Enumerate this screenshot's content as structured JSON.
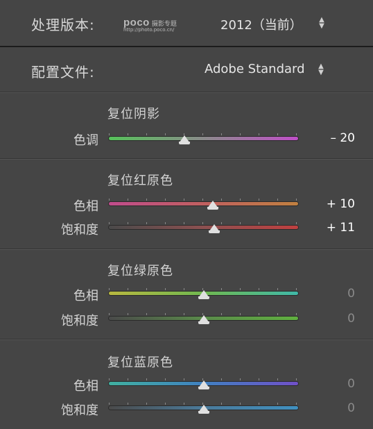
{
  "header": {
    "process_label": "处理版本:",
    "process_value": "2012（当前）",
    "profile_label": "配置文件:",
    "profile_value": "Adobe Standard"
  },
  "watermark": {
    "brand": "poco",
    "tagline": "摄影专题",
    "url": "http://photo.poco.cn/"
  },
  "groups": [
    {
      "title": "复位阴影",
      "rows": [
        {
          "label": "色调",
          "value": "– 20",
          "level": 0.4
        }
      ]
    },
    {
      "title": "复位红原色",
      "rows": [
        {
          "label": "色相",
          "value": "+ 10",
          "level": 0.55
        },
        {
          "label": "饱和度",
          "value": "+ 11",
          "level": 0.555
        }
      ]
    },
    {
      "title": "复位绿原色",
      "rows": [
        {
          "label": "色相",
          "value": "0",
          "level": 0.5
        },
        {
          "label": "饱和度",
          "value": "0",
          "level": 0.5
        }
      ]
    },
    {
      "title": "复位蓝原色",
      "rows": [
        {
          "label": "色相",
          "value": "0",
          "level": 0.5
        },
        {
          "label": "饱和度",
          "value": "0",
          "level": 0.5
        }
      ]
    }
  ],
  "colors": {
    "background": "#454545",
    "shadow_tint_track": [
      "#56c25a",
      "#8a8a8a",
      "#c04fc8"
    ],
    "red_hue_track": [
      "#c04c8c",
      "#c06060",
      "#c08040"
    ],
    "red_sat_track": [
      "#4a4a4a",
      "#8c5050",
      "#c04040"
    ],
    "green_hue_track": [
      "#b8b840",
      "#70b850",
      "#40b8a8"
    ],
    "green_sat_track": [
      "#4a4a4a",
      "#5a8a4a",
      "#60b040"
    ],
    "blue_hue_track": [
      "#40b0a0",
      "#4080c0",
      "#7050c8"
    ],
    "blue_sat_track": [
      "#4a4a4a",
      "#4a7a9a",
      "#4090c0"
    ]
  }
}
